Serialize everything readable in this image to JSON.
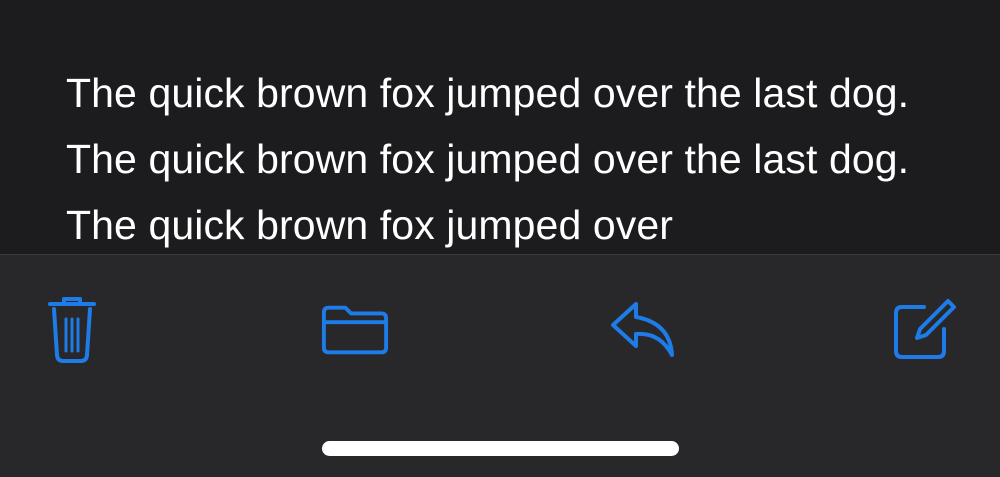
{
  "message": {
    "body": "The quick brown fox jumped over the last dog. The quick brown fox jumped over the last dog. The quick brown fox jumped over"
  },
  "toolbar": {
    "accent_color": "#1e7ce8",
    "items": [
      {
        "name": "trash",
        "icon": "trash-icon"
      },
      {
        "name": "folder",
        "icon": "folder-icon"
      },
      {
        "name": "reply",
        "icon": "reply-icon"
      },
      {
        "name": "compose",
        "icon": "compose-icon"
      }
    ]
  }
}
